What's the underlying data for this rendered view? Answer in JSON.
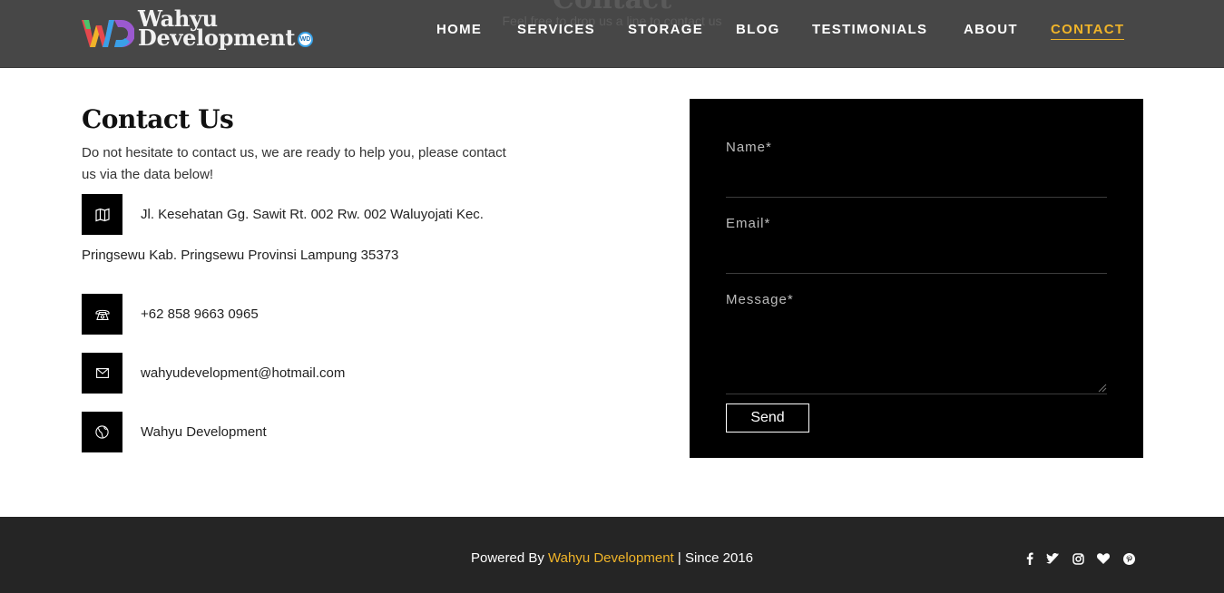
{
  "header": {
    "ghost_title": "Contact",
    "ghost_subtitle": "Feel free to drop us a line to contact us",
    "logo": {
      "line1": "Wahyu",
      "line2": "Development",
      "badge": "WD",
      "mark_text": "WD"
    },
    "nav": [
      {
        "label": "HOME",
        "active": false
      },
      {
        "label": "SERVICES",
        "active": false
      },
      {
        "label": "STORAGE",
        "active": false
      },
      {
        "label": "BLOG",
        "active": false
      },
      {
        "label": "TESTIMONIALS",
        "active": false
      },
      {
        "label": "ABOUT",
        "active": false
      },
      {
        "label": "CONTACT",
        "active": true
      }
    ]
  },
  "contact": {
    "title": "Contact Us",
    "description": "Do not hesitate to contact us, we are ready to help you, please contact us via the data below!",
    "address_line1": "Jl. Kesehatan Gg. Sawit Rt. 002 Rw. 002 Waluyojati Kec.",
    "address_line2": "Pringsewu Kab. Pringsewu Provinsi Lampung 35373",
    "phone": "+62 858 9663 0965",
    "email": "wahyudevelopment@hotmail.com",
    "website": "Wahyu Development",
    "icons": [
      "map-icon",
      "phone-icon",
      "envelope-icon",
      "globe-icon"
    ]
  },
  "form": {
    "name_label": "Name*",
    "email_label": "Email*",
    "message_label": "Message*",
    "name_value": "",
    "email_value": "",
    "message_value": "",
    "send_label": "Send"
  },
  "footer": {
    "prefix": "Powered By ",
    "brand": "Wahyu Development",
    "suffix": " | Since 2016",
    "social_icons": [
      "facebook-icon",
      "twitter-icon",
      "instagram-icon",
      "heart-icon",
      "pinterest-icon"
    ]
  },
  "colors": {
    "header_bg": "#474747",
    "accent": "#f0b429",
    "form_bg": "#000000",
    "footer_bg": "#252525"
  }
}
